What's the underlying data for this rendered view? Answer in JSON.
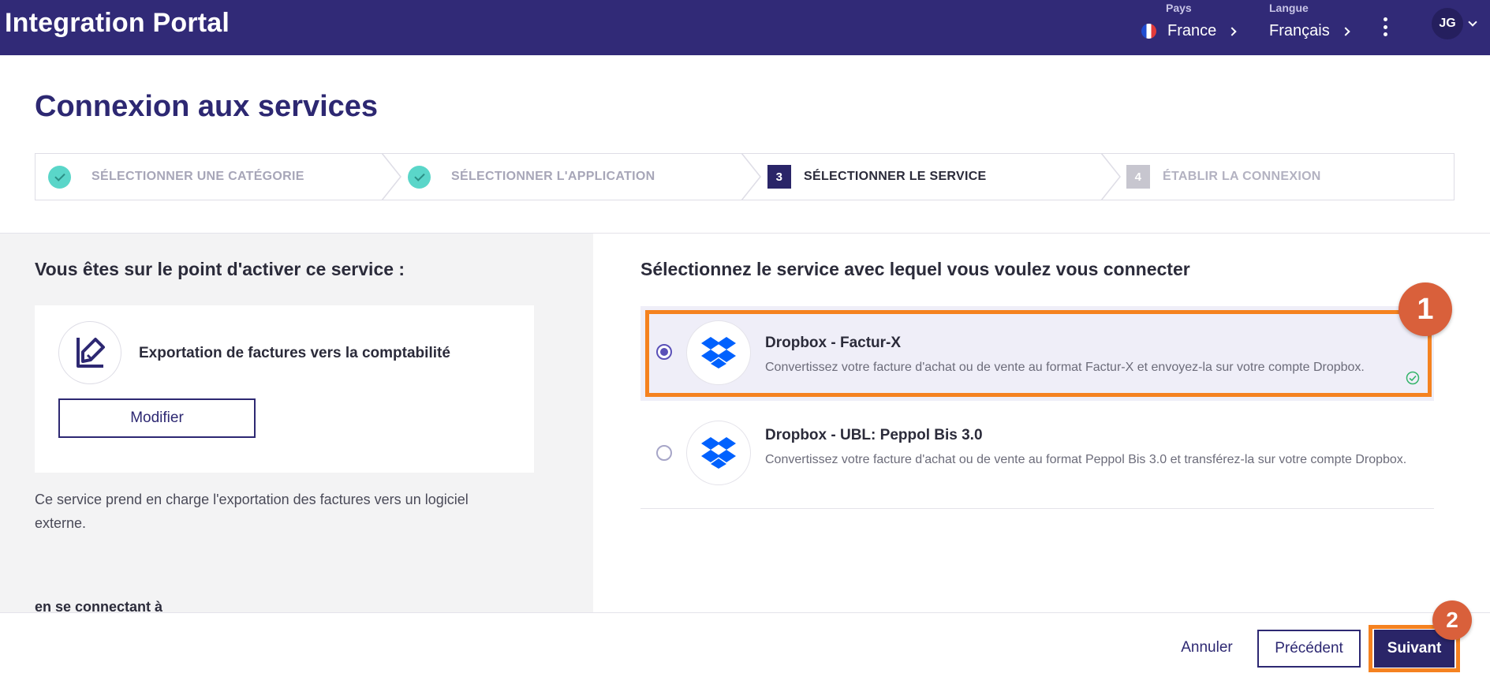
{
  "app": {
    "title": "Integration Portal"
  },
  "header": {
    "country": {
      "label": "Pays",
      "value": "France",
      "icon": "france-flag-icon"
    },
    "language": {
      "label": "Langue",
      "value": "Français"
    },
    "menu_icon": "kebab-menu-icon",
    "user_initials": "JG"
  },
  "page": {
    "title": "Connexion aux services"
  },
  "stepper": {
    "steps": [
      {
        "label": "SÉLECTIONNER UNE CATÉGORIE",
        "state": "done"
      },
      {
        "label": "SÉLECTIONNER L'APPLICATION",
        "state": "done"
      },
      {
        "number": "3",
        "label": "SÉLECTIONNER LE SERVICE",
        "state": "active"
      },
      {
        "number": "4",
        "label": "ÉTABLIR LA CONNEXION",
        "state": "todo"
      }
    ]
  },
  "left": {
    "heading": "Vous êtes sur le point d'activer ce service :",
    "service_name": "Exportation de factures vers la comptabilité",
    "modify_label": "Modifier",
    "description": "Ce service prend en charge l'exportation des factures vers un logiciel externe.",
    "subheading": "en se connectant à"
  },
  "right": {
    "heading": "Sélectionnez le service avec lequel vous voulez vous connecter",
    "options": [
      {
        "title": "Dropbox - Factur-X",
        "description": "Convertissez votre facture d'achat ou de vente au format Factur-X et envoyez-la sur votre compte Dropbox.",
        "selected": true
      },
      {
        "title": "Dropbox - UBL: Peppol Bis 3.0",
        "description": "Convertissez votre facture d'achat ou de vente au format Peppol Bis 3.0 et transférez-la sur votre compte Dropbox.",
        "selected": false
      }
    ]
  },
  "annotations": {
    "callout_1": "1",
    "callout_2": "2"
  },
  "footer": {
    "cancel_label": "Annuler",
    "previous_label": "Précédent",
    "next_label": "Suivant"
  },
  "colors": {
    "topbar": "#312a77",
    "primary": "#2a2568",
    "accent_teal": "#5ad6c9",
    "highlight": "#f58220",
    "callout": "#d9603b",
    "dropbox": "#0061fe"
  }
}
